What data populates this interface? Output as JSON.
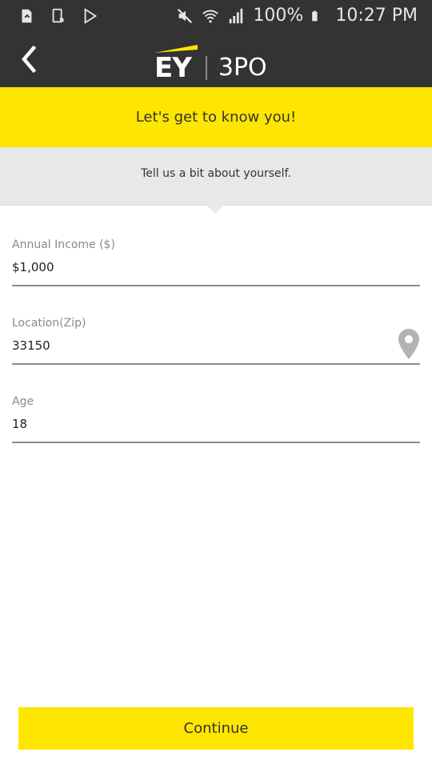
{
  "status_bar": {
    "battery_text": "100%",
    "time": "10:27 PM",
    "icons": [
      "sd-card-icon",
      "screenshot-icon",
      "play-store-icon",
      "mute-icon",
      "wifi-icon",
      "signal-icon",
      "battery-icon"
    ]
  },
  "app_bar": {
    "logo_brand": "EY",
    "logo_product": "3PO",
    "brand_color": "#ffe600"
  },
  "banner": {
    "title": "Let's get to know you!"
  },
  "subheader": {
    "text": "Tell us a bit about yourself."
  },
  "form": {
    "income": {
      "label": "Annual Income ($)",
      "value": "$1,000"
    },
    "location": {
      "label": "Location(Zip)",
      "value": "33150"
    },
    "age": {
      "label": "Age",
      "value": "18"
    }
  },
  "continue_label": "Continue"
}
